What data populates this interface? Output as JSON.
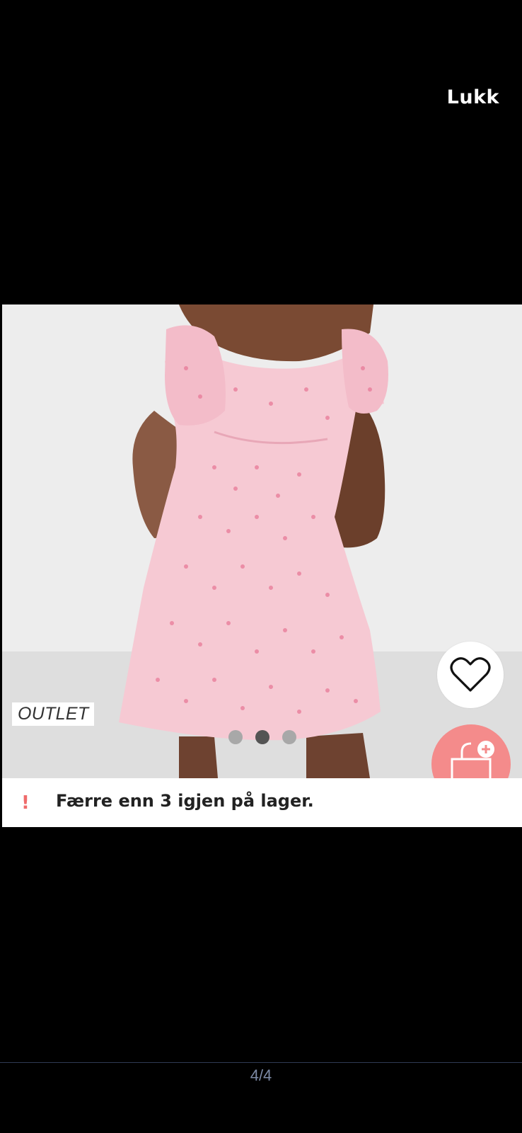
{
  "header": {
    "close_label": "Lukk"
  },
  "product": {
    "badge_label": "OUTLET",
    "image_description_name": "product-photo",
    "carousel": {
      "total_dots": 3,
      "active_index": 1
    },
    "stock_icon": "!",
    "stock_message": "Færre enn 3 igjen på lager."
  },
  "footer": {
    "page_counter": "4/4"
  },
  "colors": {
    "background": "#000000",
    "accent_cart": "#f48b8b",
    "stock_warning": "#ef6b6b",
    "dress_pink": "#f6c9d3"
  },
  "icons": {
    "favorite": "heart-icon",
    "cart": "shopping-bag-add-icon"
  }
}
